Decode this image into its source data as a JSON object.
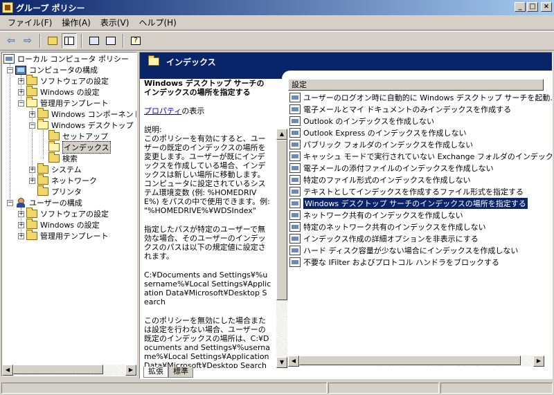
{
  "window": {
    "title": "グループ ポリシー"
  },
  "menu": [
    "ファイル(F)",
    "操作(A)",
    "表示(V)",
    "ヘルプ(H)"
  ],
  "tree": {
    "root": "ローカル コンピュータ ポリシー",
    "computer": "コンピュータの構成",
    "computer_children": [
      "ソフトウェアの設定",
      "Windows の設定",
      "管理用テンプレート"
    ],
    "admin_children": [
      "Windows コンポーネント",
      "Windows デスクトップ サ"
    ],
    "desktop_search_children": [
      "セットアップ",
      "インデックス",
      "検索"
    ],
    "other_admin": [
      "システム",
      "ネットワーク",
      "プリンタ"
    ],
    "user": "ユーザーの構成",
    "user_children": [
      "ソフトウェアの設定",
      "Windows の設定",
      "管理用テンプレート"
    ]
  },
  "header": {
    "title": "インデックス"
  },
  "description": {
    "title": "Windows デスクトップ サーチのインデックスの場所を指定する",
    "link": "プロパティ",
    "link_suffix": "の表示",
    "label": "説明:",
    "p1": "このポリシーを有効にすると、ユーザーの既定のインデックスの場所を変更します。ユーザーが既にインデックスを作成している場合、インデックスは新しい場所に移動します。コンピュータに設定されているシステム環境変数 (例: %HOMEDRIVE%) をパスの中で使用できます。例: \"%HOMEDRIVE%¥WDSIndex\"",
    "p2": "指定したパスが特定のユーザーで無効な場合、そのユーザーのインデックスのパスは以下の規定値に設定されます。",
    "p3": "C:¥Documents and Settings¥%username%¥Local Settings¥Application Data¥Microsoft¥Desktop Search",
    "p4": "このポリシーを無効にした場合または設定を行わない場合、ユーザーの既定のインデックスの場所は、C:¥Documents and Settings¥%username%¥Local Settings¥Application Data¥Microsoft¥Desktop Search になります。一度このポリシーを有効にした"
  },
  "list": {
    "column": "設定",
    "items": [
      "ユーザーのログオン時に自動的に Windows デスクトップ サーチを起動…",
      "電子メールとマイ ドキュメントのみインデックスを作成する",
      "Outlook のインデックスを作成しない",
      "Outlook Express のインデックスを作成しない",
      "パブリック フォルダのインデックスを作成しない",
      "キャッシュ モードで実行されていない Exchange フォルダのインデックス…",
      "電子メールの添付ファイルのインデックスを作成しない",
      "特定のファイル形式のインデックスを作成しない",
      "テキストとしてインデックスを作成するファイル形式を指定する",
      "Windows デスクトップ サーチのインデックスの場所を指定する",
      "ネットワーク共有のインデックスを作成しない",
      "特定のネットワーク共有のインデックスを作成しない",
      "インデックス作成の詳細オプションを非表示にする",
      "ハード ディスク容量が少ない場合にインデックスを作成しない",
      "不要な IFilter およびプロトコル ハンドラをブロックする"
    ]
  },
  "tabs": [
    "拡張",
    "標準"
  ]
}
